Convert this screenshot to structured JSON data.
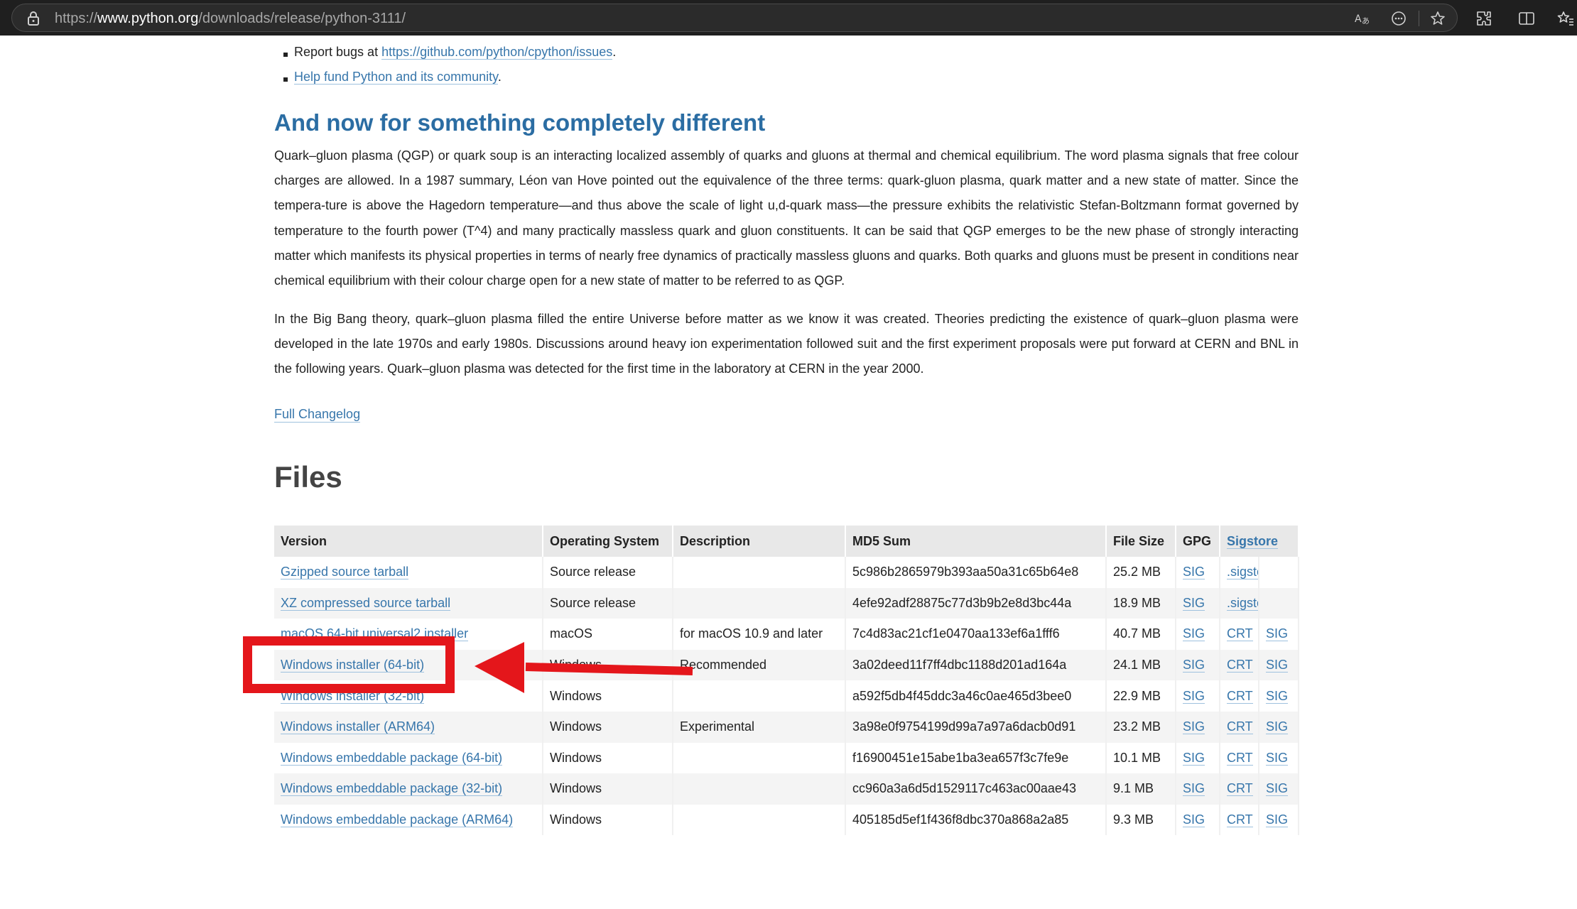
{
  "browser": {
    "url_prefix": "https://",
    "url_host": "www.python.org",
    "url_path": "/downloads/release/python-3111/",
    "icons": [
      "lock-icon",
      "read-aloud-icon",
      "more-tools-icon",
      "favorite-star-icon",
      "extensions-icon",
      "split-screen-icon",
      "favorites-icon"
    ]
  },
  "bullets": {
    "report_prefix": "Report bugs at ",
    "report_link": "https://github.com/python/cpython/issues",
    "report_suffix": ".",
    "fund_link": "Help fund Python and its community",
    "fund_suffix": "."
  },
  "section": {
    "heading": "And now for something completely different",
    "para1": "Quark–gluon plasma (QGP) or quark soup is an interacting localized assembly of quarks and gluons at thermal and chemical equilibrium. The word plasma signals that free colour charges are allowed. In a 1987 summary, Léon van Hove pointed out the equivalence of the three terms: quark-gluon plasma, quark matter and a new state of matter. Since the tempera-ture is above the Hagedorn temperature—and thus above the scale of light u,d-quark mass—the pressure exhibits the relativistic Stefan-Boltzmann format governed by temperature to the fourth power (T^4) and many practically massless quark and gluon constituents. It can be said that QGP emerges to be the new phase of strongly interacting matter which manifests its physical properties in terms of nearly free dynamics of practically massless gluons and quarks. Both quarks and gluons must be present in conditions near chemical equilibrium with their colour charge open for a new state of matter to be referred to as QGP.",
    "para2": "In the Big Bang theory, quark–gluon plasma filled the entire Universe before matter as we know it was created. Theories predicting the existence of quark–gluon plasma were developed in the late 1970s and early 1980s. Discussions around heavy ion experimentation followed suit and the first experiment proposals were put forward at CERN and BNL in the following years. Quark–gluon plasma was detected for the first time in the laboratory at CERN in the year 2000.",
    "changelog": "Full Changelog"
  },
  "files": {
    "heading": "Files",
    "headers": [
      "Version",
      "Operating System",
      "Description",
      "MD5 Sum",
      "File Size",
      "GPG",
      "Sigstore"
    ],
    "rows": [
      {
        "version": "Gzipped source tarball",
        "os": "Source release",
        "desc": "",
        "md5": "5c986b2865979b393aa50a31c65b64e8",
        "size": "25.2 MB",
        "gpg": "SIG",
        "s1": ".sigstore",
        "s2": ""
      },
      {
        "version": "XZ compressed source tarball",
        "os": "Source release",
        "desc": "",
        "md5": "4efe92adf28875c77d3b9b2e8d3bc44a",
        "size": "18.9 MB",
        "gpg": "SIG",
        "s1": ".sigstore",
        "s2": ""
      },
      {
        "version": "macOS 64-bit universal2 installer",
        "os": "macOS",
        "desc": "for macOS 10.9 and later",
        "md5": "7c4d83ac21cf1e0470aa133ef6a1fff6",
        "size": "40.7 MB",
        "gpg": "SIG",
        "s1": "CRT",
        "s2": "SIG"
      },
      {
        "version": "Windows installer (64-bit)",
        "os": "Windows",
        "desc": "Recommended",
        "md5": "3a02deed11f7ff4dbc1188d201ad164a",
        "size": "24.1 MB",
        "gpg": "SIG",
        "s1": "CRT",
        "s2": "SIG"
      },
      {
        "version": "Windows installer (32-bit)",
        "os": "Windows",
        "desc": "",
        "md5": "a592f5db4f45ddc3a46c0ae465d3bee0",
        "size": "22.9 MB",
        "gpg": "SIG",
        "s1": "CRT",
        "s2": "SIG"
      },
      {
        "version": "Windows installer (ARM64)",
        "os": "Windows",
        "desc": "Experimental",
        "md5": "3a98e0f9754199d99a7a97a6dacb0d91",
        "size": "23.2 MB",
        "gpg": "SIG",
        "s1": "CRT",
        "s2": "SIG"
      },
      {
        "version": "Windows embeddable package (64-bit)",
        "os": "Windows",
        "desc": "",
        "md5": "f16900451e15abe1ba3ea657f3c7fe9e",
        "size": "10.1 MB",
        "gpg": "SIG",
        "s1": "CRT",
        "s2": "SIG"
      },
      {
        "version": "Windows embeddable package (32-bit)",
        "os": "Windows",
        "desc": "",
        "md5": "cc960a3a6d5d1529117c463ac00aae43",
        "size": "9.1 MB",
        "gpg": "SIG",
        "s1": "CRT",
        "s2": "SIG"
      },
      {
        "version": "Windows embeddable package (ARM64)",
        "os": "Windows",
        "desc": "",
        "md5": "405185d5ef1f436f8dbc370a868a2a85",
        "size": "9.3 MB",
        "gpg": "SIG",
        "s1": "CRT",
        "s2": "SIG"
      }
    ]
  },
  "annotation": {
    "color": "#e4161b"
  }
}
